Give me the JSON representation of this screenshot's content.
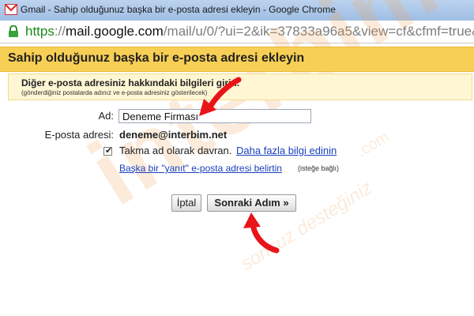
{
  "window": {
    "title": "Gmail - Sahip olduğunuz başka bir e-posta adresi ekleyin - Google Chrome",
    "app_icon": "gmail-icon"
  },
  "address_bar": {
    "scheme": "https",
    "separator": "://",
    "host": "mail.google.com",
    "path": "/mail/u/0/?ui=2&ik=37833a96a5&view=cf&cfmf=true&c",
    "lock_icon": "lock-icon"
  },
  "dialog": {
    "title": "Sahip olduğunuz başka bir e-posta adresi ekleyin",
    "info_title": "Diğer e-posta adresiniz hakkındaki bilgileri girin.",
    "info_subtitle": "(gönderdiğiniz postalarda adınız ve e-posta adresiniz gösterilecek)",
    "name_label": "Ad:",
    "name_value": "Deneme Firması",
    "email_label": "E-posta adresi:",
    "email_value": "deneme@interbim.net",
    "alias_checked": true,
    "alias_label": "Takma ad olarak davran.",
    "more_info_link": "Daha fazla bilgi edinin",
    "reply_link": "Başka bir \"yanıt\" e-posta adresi belirtin",
    "optional_label": "(isteğe bağlı)",
    "cancel_label": "İptal",
    "next_label": "Sonraki Adım »"
  },
  "watermark": {
    "brand": "interbim",
    "domain": ".com",
    "tagline": "sonsuz desteğiniz"
  },
  "colors": {
    "header_bg": "#f8cf55",
    "info_bg": "#fff6d4",
    "link": "#1a3fbd",
    "https_green": "#1b8a1b",
    "arrow_red": "#e8141a"
  }
}
